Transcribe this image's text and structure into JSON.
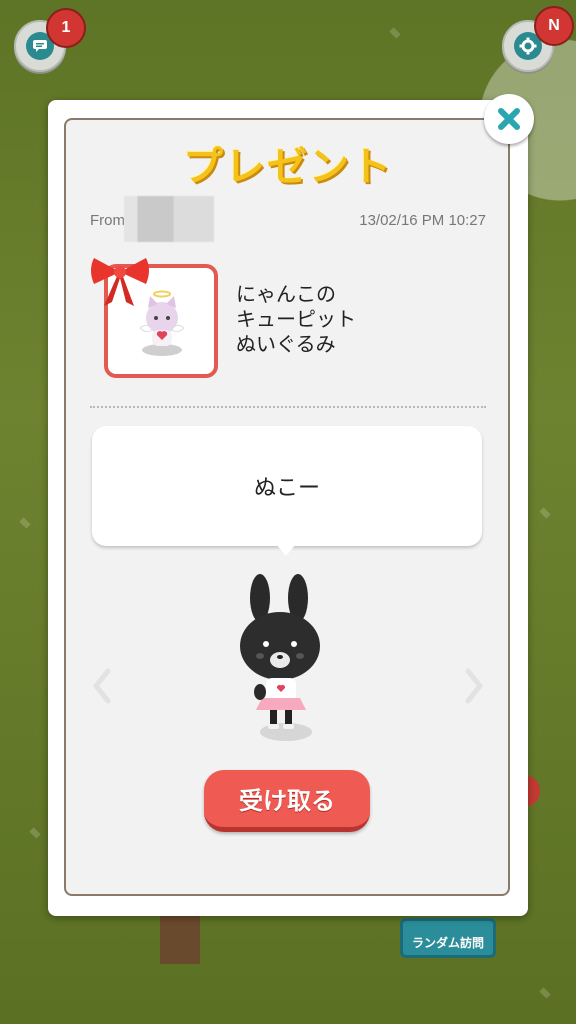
{
  "background": {
    "chat_badge": "1",
    "settings_badge": "N",
    "random_visit_label": "ランダム訪問"
  },
  "modal": {
    "title": "プレゼント",
    "from_label": "From",
    "timestamp": "13/02/16 PM 10:27",
    "item_name": "にゃんこの\nキューピット\nぬいぐるみ",
    "message": "ぬこー",
    "receive_button": "受け取る"
  },
  "icons": {
    "close": "close-icon",
    "chat": "chat-icon",
    "settings": "gear-icon",
    "prev": "chevron-left-icon",
    "next": "chevron-right-icon"
  },
  "colors": {
    "accent_teal": "#2aa6b0",
    "title_yellow": "#f5c21a",
    "button_red": "#ef5b52"
  }
}
